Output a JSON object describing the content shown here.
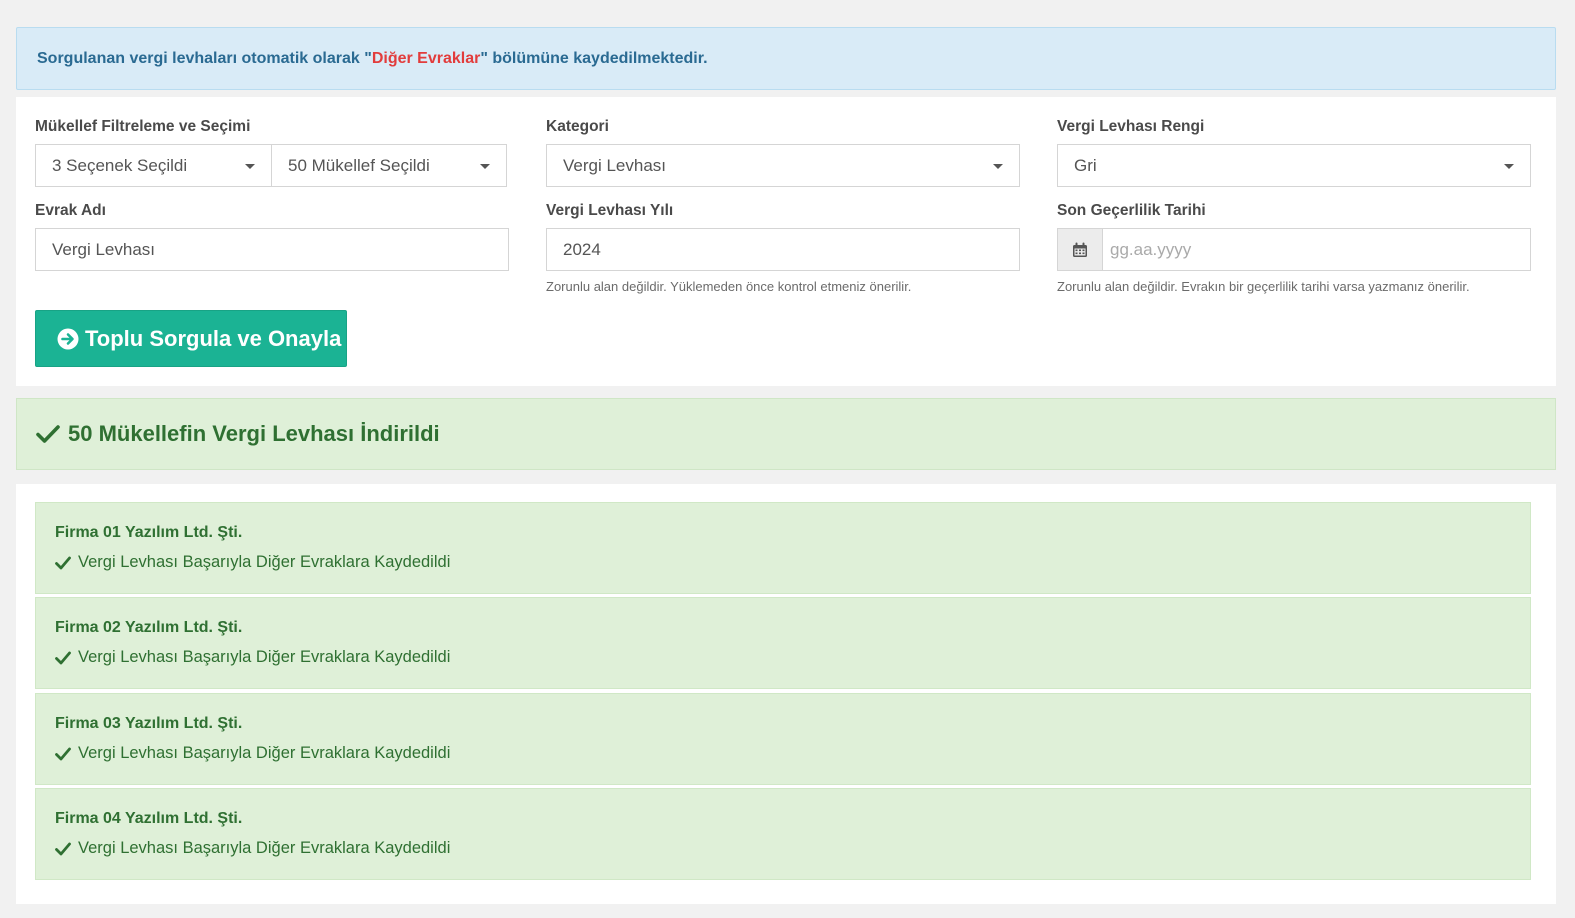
{
  "info_alert": {
    "prefix": "Sorgulanan vergi levhaları otomatik olarak \"",
    "highlight": "Diğer Evraklar",
    "suffix": "\" bölümüne kaydedilmektedir.",
    "highlight_color": "#e23c3c"
  },
  "form": {
    "taxpayer_filter": {
      "label": "Mükellef Filtreleme ve Seçimi",
      "options_value": "3 Seçenek Seçildi",
      "taxpayers_value": "50 Mükellef Seçildi"
    },
    "category": {
      "label": "Kategori",
      "value": "Vergi Levhası"
    },
    "plate_color": {
      "label": "Vergi Levhası Rengi",
      "value": "Gri"
    },
    "document_name": {
      "label": "Evrak Adı",
      "value": "Vergi Levhası"
    },
    "plate_year": {
      "label": "Vergi Levhası Yılı",
      "value": "2024",
      "help": "Zorunlu alan değildir. Yüklemeden önce kontrol etmeniz önerilir."
    },
    "expiry_date": {
      "label": "Son Geçerlilik Tarihi",
      "placeholder": "gg.aa.yyyy",
      "help": "Zorunlu alan değildir. Evrakın bir geçerlilik tarihi varsa yazmanız önerilir.",
      "icon": "calendar-icon"
    },
    "submit_label": "Toplu Sorgula ve Onayla",
    "submit_icon": "arrow-circle-right-icon",
    "accent_color": "#1bb394"
  },
  "result_banner": {
    "text": "50 Mükellefin Vergi Levhası İndirildi",
    "icon": "check-icon",
    "color": "#2f7032"
  },
  "results": [
    {
      "company": "Firma 01 Yazılım Ltd. Şti.",
      "status": "Vergi Levhası Başarıyla Diğer Evraklara Kaydedildi"
    },
    {
      "company": "Firma 02 Yazılım Ltd. Şti.",
      "status": "Vergi Levhası Başarıyla Diğer Evraklara Kaydedildi"
    },
    {
      "company": "Firma 03 Yazılım Ltd. Şti.",
      "status": "Vergi Levhası Başarıyla Diğer Evraklara Kaydedildi"
    },
    {
      "company": "Firma 04 Yazılım Ltd. Şti.",
      "status": "Vergi Levhası Başarıyla Diğer Evraklara Kaydedildi"
    }
  ]
}
